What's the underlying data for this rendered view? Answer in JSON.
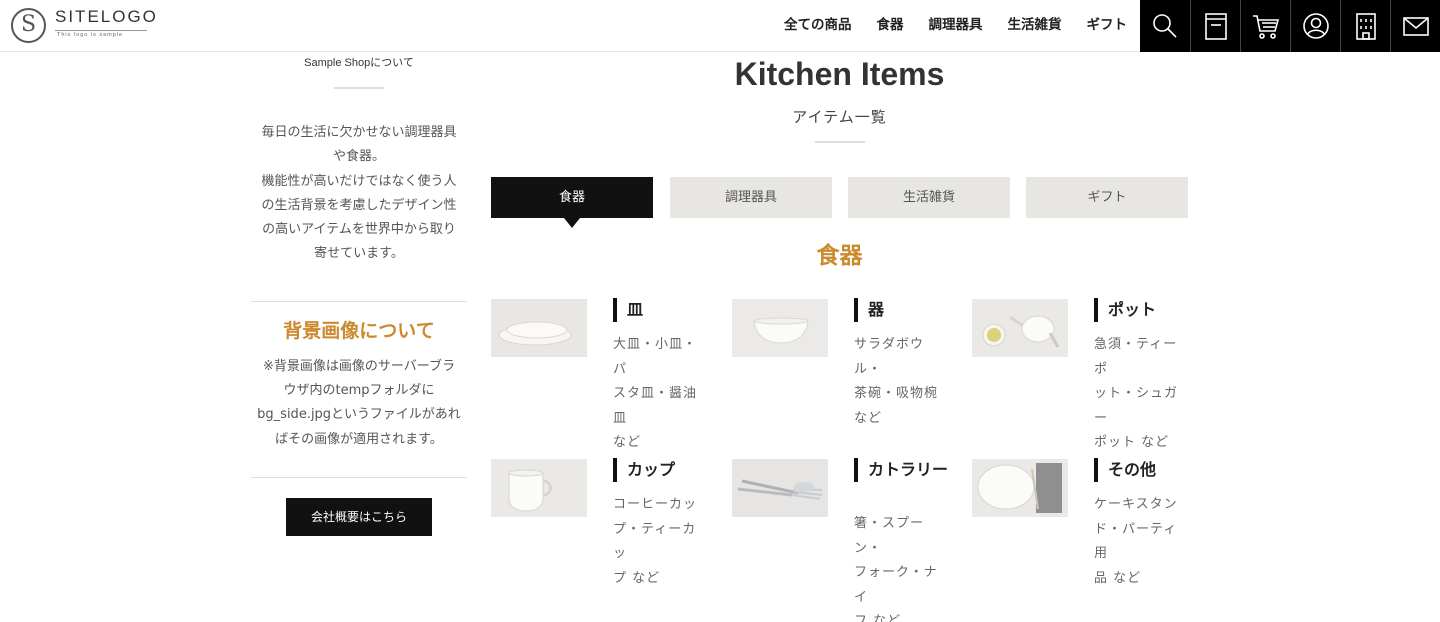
{
  "header": {
    "logo_text": "SITELOGO",
    "logo_sub": "This logo is sample",
    "logo_mark": "S",
    "nav": [
      "全ての商品",
      "食器",
      "調理器具",
      "生活雑貨",
      "ギフト"
    ],
    "icons": [
      "search-icon",
      "catalog-icon",
      "cart-icon",
      "user-icon",
      "company-icon",
      "mail-icon"
    ]
  },
  "sidebar": {
    "caption": "Sample Shopについて",
    "text": [
      "毎日の生活に欠かせない調理器具",
      "や食器。",
      "機能性が高いだけではなく使う人",
      "の生活背景を考慮したデザイン性",
      "の高いアイテムを世界中から取り",
      "寄せています。"
    ],
    "bg_heading": "背景画像について",
    "note": [
      "※背景画像は画像のサーバーブラ",
      "ウザ内のtempフォルダに",
      "bg_side.jpgというファイルがあれ",
      "ばその画像が適用されます。"
    ],
    "company_button": "会社概要はこちら"
  },
  "main": {
    "title": "Kitchen Items",
    "subtitle": "アイテム一覧",
    "tabs": [
      {
        "label": "食器",
        "active": true
      },
      {
        "label": "調理器具",
        "active": false
      },
      {
        "label": "生活雑貨",
        "active": false
      },
      {
        "label": "ギフト",
        "active": false
      }
    ],
    "section_title": "食器",
    "items": [
      {
        "title": "皿",
        "desc": [
          "大皿・小皿・パ",
          "スタ皿・醤油皿",
          "など"
        ]
      },
      {
        "title": "器",
        "desc": [
          "サラダボウル・",
          "茶碗・吸物椀",
          "など"
        ]
      },
      {
        "title": "ポット",
        "desc": [
          "急須・ティーポ",
          "ット・シュガー",
          "ポット など"
        ]
      },
      {
        "title": "カップ",
        "desc": [
          "コーヒーカッ",
          "プ・ティーカッ",
          "プ など"
        ]
      },
      {
        "title": "カトラリー",
        "desc": [
          "箸・スプーン・",
          "フォーク・ナイ",
          "フ など"
        ]
      },
      {
        "title": "その他",
        "desc": [
          "ケーキスタン",
          "ド・パーティ用",
          "品 など"
        ]
      }
    ]
  },
  "colors": {
    "accent": "#cc8a2e",
    "dark": "#111111",
    "tab_bg": "#e8e6e3"
  }
}
